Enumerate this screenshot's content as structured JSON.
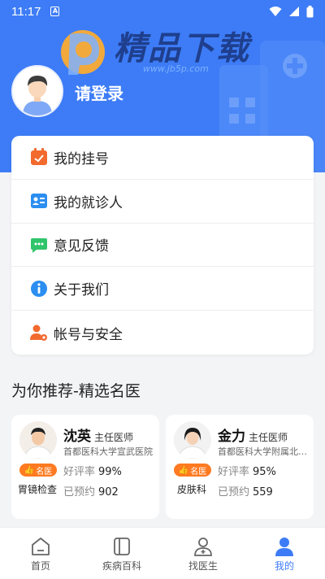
{
  "status_bar": {
    "time": "11:17",
    "sim": "A"
  },
  "watermark": {
    "title": "精品下载",
    "url": "www.jb5p.com"
  },
  "profile": {
    "login_label": "请登录"
  },
  "menu": {
    "items": [
      {
        "label": "我的挂号",
        "icon": "calendar-icon",
        "color": "#f26a2e"
      },
      {
        "label": "我的就诊人",
        "icon": "id-card-icon",
        "color": "#2b8ef0"
      },
      {
        "label": "意见反馈",
        "icon": "chat-bubble-icon",
        "color": "#30c46b"
      },
      {
        "label": "关于我们",
        "icon": "info-icon",
        "color": "#2b8ef0"
      },
      {
        "label": "帐号与安全",
        "icon": "user-settings-icon",
        "color": "#f26a2e"
      }
    ]
  },
  "recommend": {
    "title": "为你推荐-精选名医",
    "doctors": [
      {
        "name": "沈英",
        "title": "主任医师",
        "hospital": "首都医科大学宣武医院",
        "badge": "名医",
        "dept": "胃镜检查",
        "rating_label": "好评率",
        "rating": "99%",
        "booked_label": "已预约",
        "booked": "902"
      },
      {
        "name": "金力",
        "title": "主任医师",
        "hospital": "首都医科大学附属北京…",
        "badge": "名医",
        "dept": "皮肤科",
        "rating_label": "好评率",
        "rating": "95%",
        "booked_label": "已预约",
        "booked": "559"
      }
    ]
  },
  "tabs": [
    {
      "label": "首页",
      "icon": "home-icon",
      "active": false
    },
    {
      "label": "疾病百科",
      "icon": "book-icon",
      "active": false
    },
    {
      "label": "找医生",
      "icon": "doctor-icon",
      "active": false
    },
    {
      "label": "我的",
      "icon": "person-icon",
      "active": true
    }
  ],
  "colors": {
    "primary": "#3d7cf6",
    "badge": "#ff7a21"
  }
}
